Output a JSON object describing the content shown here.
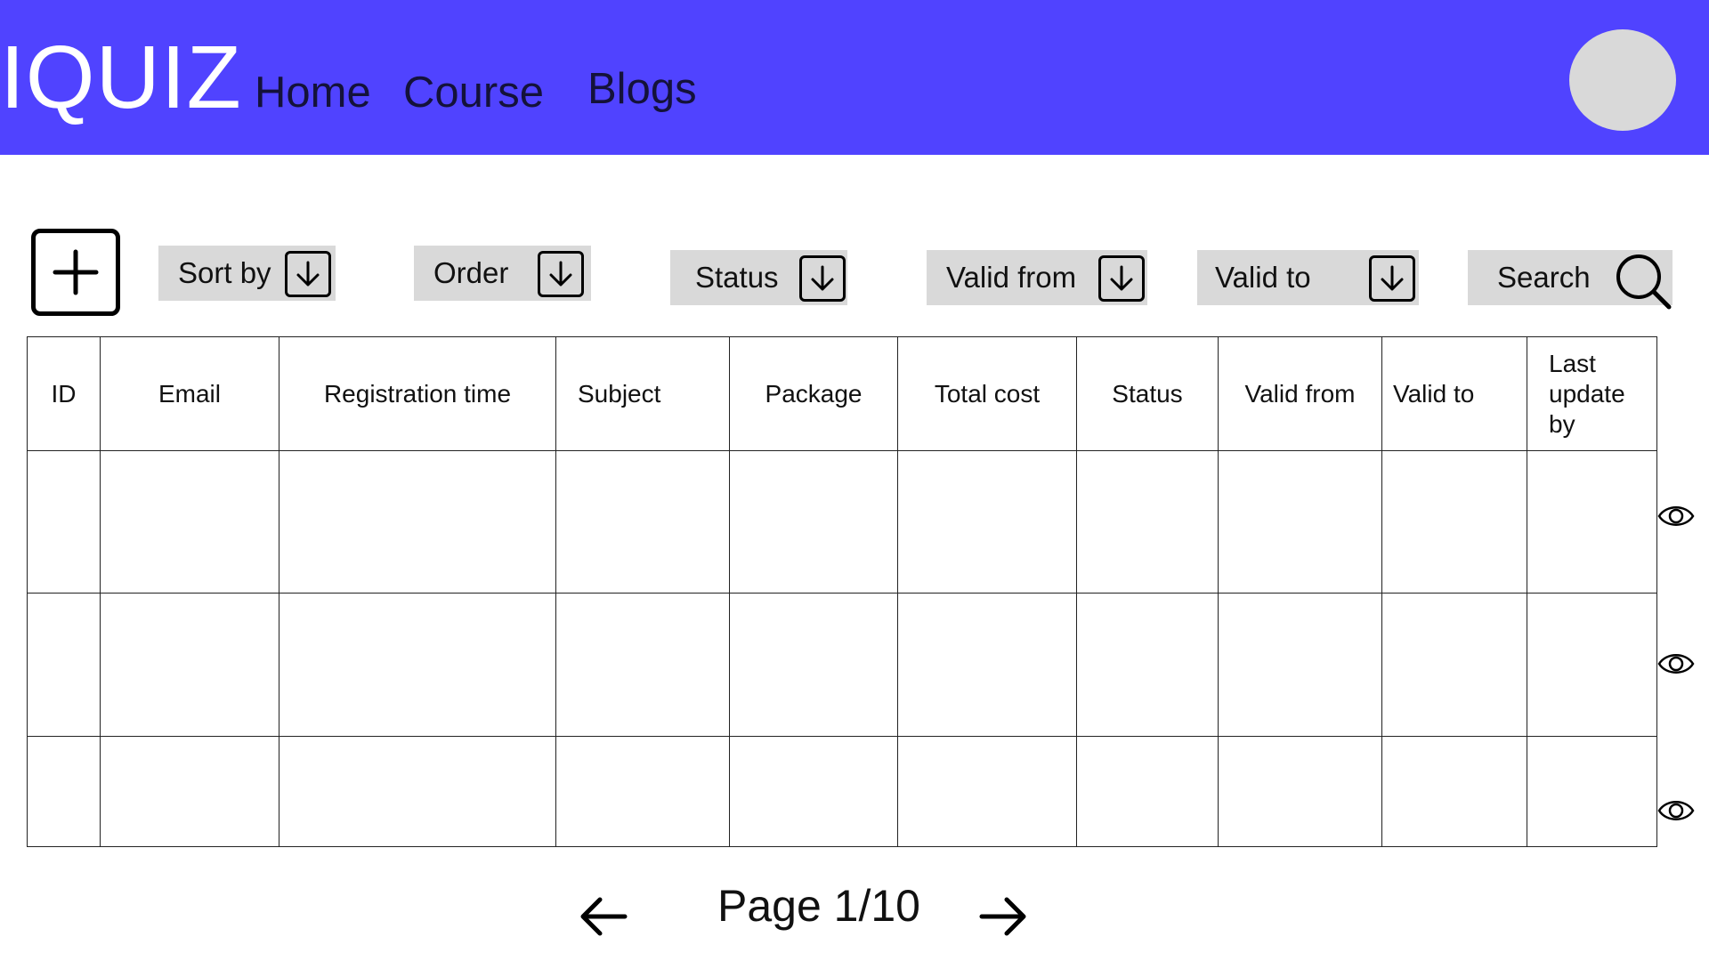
{
  "header": {
    "logo": "IQUIZ",
    "nav": [
      "Home",
      "Course",
      "Blogs"
    ],
    "brand_color": "#5043ff",
    "avatar_icon": "user-avatar-placeholder"
  },
  "toolbar": {
    "add_icon": "plus-icon",
    "filters": [
      {
        "label": "Sort by",
        "icon": "arrow-down-icon"
      },
      {
        "label": "Order",
        "icon": "arrow-down-icon"
      },
      {
        "label": "Status",
        "icon": "arrow-down-icon"
      },
      {
        "label": "Valid from",
        "icon": "arrow-down-icon"
      },
      {
        "label": "Valid to",
        "icon": "arrow-down-icon"
      }
    ],
    "search": {
      "label": "Search",
      "icon": "search-icon"
    }
  },
  "table": {
    "columns": [
      "ID",
      "Email",
      "Registration time",
      "Subject",
      "Package",
      "Total cost",
      "Status",
      "Valid from",
      "Valid to",
      "Last update by"
    ],
    "rows": [
      {
        "cells": [
          "",
          "",
          "",
          "",
          "",
          "",
          "",
          "",
          "",
          ""
        ],
        "action_icon": "eye-icon"
      },
      {
        "cells": [
          "",
          "",
          "",
          "",
          "",
          "",
          "",
          "",
          "",
          ""
        ],
        "action_icon": "eye-icon"
      },
      {
        "cells": [
          "",
          "",
          "",
          "",
          "",
          "",
          "",
          "",
          "",
          ""
        ],
        "action_icon": "eye-icon"
      }
    ]
  },
  "pagination": {
    "label": "Page 1/10",
    "prev_icon": "arrow-left-icon",
    "next_icon": "arrow-right-icon"
  }
}
